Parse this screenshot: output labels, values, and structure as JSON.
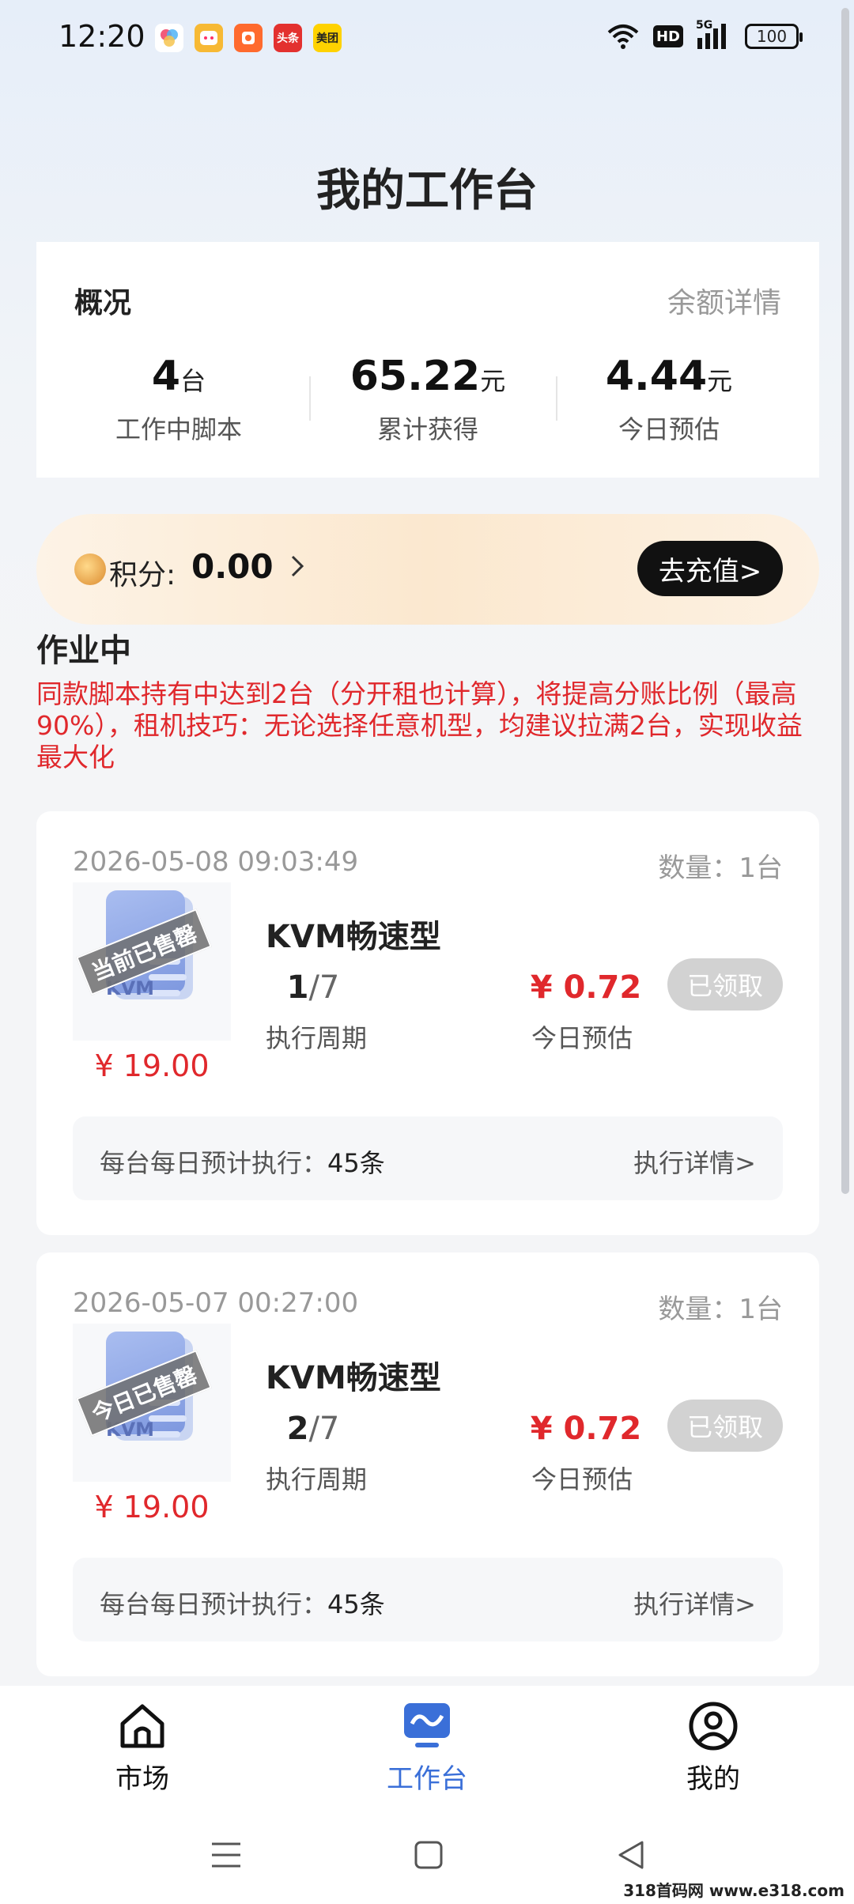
{
  "status_bar": {
    "time": "12:20",
    "notif_icons": [
      "app-icon-1",
      "app-icon-2",
      "app-icon-3",
      "toutiao-icon",
      "meituan-icon"
    ],
    "notif_labels": [
      "",
      "",
      "",
      "头条",
      "美团"
    ],
    "hd": "HD",
    "signal": "5G",
    "battery": "100"
  },
  "page": {
    "title": "我的工作台"
  },
  "overview": {
    "title": "概况",
    "detail_link": "余额详情",
    "stats": [
      {
        "value": "4",
        "unit": "台",
        "label": "工作中脚本"
      },
      {
        "value": "65.22",
        "unit": "元",
        "label": "累计获得"
      },
      {
        "value": "4.44",
        "unit": "元",
        "label": "今日预估"
      }
    ]
  },
  "points": {
    "label": "积分:",
    "value": "0.00",
    "recharge_label": "去充值>"
  },
  "working": {
    "title": "作业中",
    "notice": "同款脚本持有中达到2台（分开租也计算），将提高分账比例（最高90%），租机技巧：无论选择任意机型，均建议拉满2台，实现收益最大化"
  },
  "cards": [
    {
      "date": "2026-05-08 09:03:49",
      "quantity": "数量：1台",
      "stamp": "当前已售罄",
      "thumb_text": "KVM",
      "price": "¥ 19.00",
      "name": "KVM畅速型",
      "cycle_current": "1",
      "cycle_total": "/7",
      "cycle_label": "执行周期",
      "estimate": "¥ 0.72",
      "estimate_label": "今日预估",
      "status_button": "已领取",
      "footer_label": "每台每日预计执行：",
      "footer_value": "45条",
      "detail_link": "执行详情>"
    },
    {
      "date": "2026-05-07 00:27:00",
      "quantity": "数量：1台",
      "stamp": "今日已售罄",
      "thumb_text": "KVM",
      "price": "¥ 19.00",
      "name": "KVM畅速型",
      "cycle_current": "2",
      "cycle_total": "/7",
      "cycle_label": "执行周期",
      "estimate": "¥ 0.72",
      "estimate_label": "今日预估",
      "status_button": "已领取",
      "footer_label": "每台每日预计执行：",
      "footer_value": "45条",
      "detail_link": "执行详情>"
    }
  ],
  "tabbar": {
    "items": [
      {
        "label": "市场",
        "icon": "home-icon",
        "active": false
      },
      {
        "label": "工作台",
        "icon": "workbench-icon",
        "active": true
      },
      {
        "label": "我的",
        "icon": "profile-icon",
        "active": false
      }
    ],
    "active_color": "#3a6fd8"
  },
  "watermark": "318首码网 www.e318.com",
  "colors": {
    "accent_red": "#e0282c",
    "accent_blue": "#3a6fd8"
  }
}
